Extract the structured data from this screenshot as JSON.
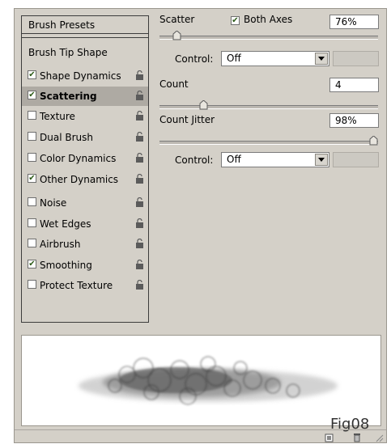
{
  "left_panel": {
    "presets_label": "Brush Presets",
    "tip_shape_label": "Brush Tip Shape",
    "items": [
      {
        "label": "Shape Dynamics",
        "checked": true
      },
      {
        "label": "Scattering",
        "checked": true,
        "selected": true
      },
      {
        "label": "Texture",
        "checked": false
      },
      {
        "label": "Dual Brush",
        "checked": false
      },
      {
        "label": "Color Dynamics",
        "checked": false
      },
      {
        "label": "Other Dynamics",
        "checked": true
      },
      {
        "label": "Noise",
        "checked": false
      },
      {
        "label": "Wet Edges",
        "checked": false
      },
      {
        "label": "Airbrush",
        "checked": false
      },
      {
        "label": "Smoothing",
        "checked": true
      },
      {
        "label": "Protect Texture",
        "checked": false
      }
    ]
  },
  "scatter": {
    "label": "Scatter",
    "both_axes_label": "Both Axes",
    "both_axes_checked": true,
    "value": "76%",
    "control_label": "Control:",
    "control_value": "Off"
  },
  "count": {
    "label": "Count",
    "value": "4"
  },
  "count_jitter": {
    "label": "Count Jitter",
    "value": "98%",
    "control_label": "Control:",
    "control_value": "Off"
  },
  "figure_label": "Fig08",
  "colors": {
    "panel_bg": "#d4d0c8",
    "selected_row": "#aeaaa3",
    "check_mark": "#2c5b17"
  }
}
